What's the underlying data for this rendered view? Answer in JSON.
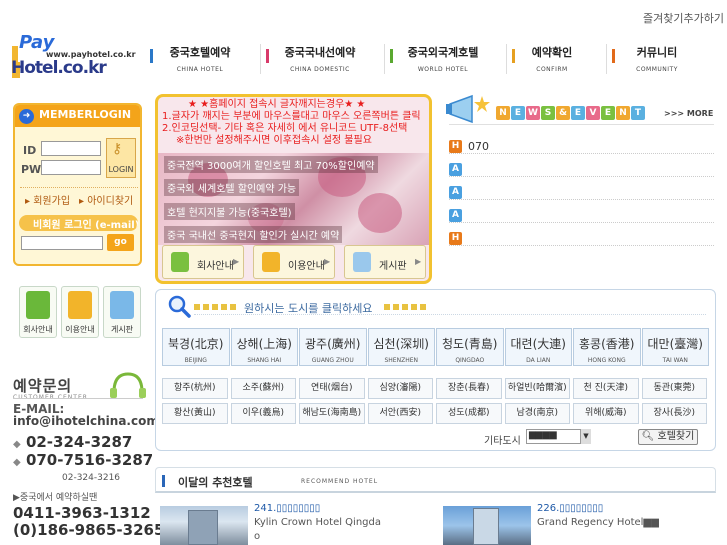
{
  "top_link": "즐겨찾기추가하기",
  "logo": {
    "line1": "Pay",
    "line2": "Hotel.co.kr",
    "url": "www.payhotel.co.kr"
  },
  "nav": [
    {
      "ko": "중국호텔예약",
      "en": "CHINA HOTEL",
      "color": "#2a78c8"
    },
    {
      "ko": "중국국내선예약",
      "en": "CHINA DOMESTIC",
      "color": "#d83a6a"
    },
    {
      "ko": "중국외국계호텔",
      "en": "WORLD HOTEL",
      "color": "#5aa830"
    },
    {
      "ko": "예약확인",
      "en": "CONFIRM",
      "color": "#e6a020"
    },
    {
      "ko": "커뮤니티",
      "en": "COMMUNITY",
      "color": "#e26a1a"
    }
  ],
  "login": {
    "title": "MEMBERLOGIN",
    "id_label": "ID",
    "pw_label": "PW",
    "login_btn": "LOGIN",
    "join": "회원가입",
    "find_id": "아이디찾기",
    "guest_label": "비회원 로그인 (e-mail)",
    "go_btn": "go"
  },
  "icon_buttons": [
    {
      "label": "회사안내",
      "color": "#6ab83a"
    },
    {
      "label": "이용안내",
      "color": "#f2b42a"
    },
    {
      "label": "게시판",
      "color": "#7ab8e8"
    }
  ],
  "contact": {
    "title": "예약문의",
    "subtitle": "CUSTOMER CENTER",
    "email_label": "E-MAIL:",
    "email": "info@ihotelchina.com",
    "phone1": "02-324-3287",
    "phone2": "070-7516-3287",
    "fax": "02-324-3216",
    "china_label": "▶중국에서 예약하실땐",
    "china_phone1": "0411-3963-1312",
    "china_phone2": "(0)186-9865-3265"
  },
  "hero": {
    "notice": [
      "★ ★홈페이지 접속시 글자깨지는경우★ ★",
      "1.글자가 깨지는 부분에 마우스를대고 마우스 오른쪽버튼 클릭",
      "2.인코딩선택- 기타 혹은 자세히 에서 유니코드 UTF-8선택",
      "※한번만 설정해주시면 이후접속시 설정 불필요"
    ],
    "promo": [
      "중국전역 3000여개 할인호텔 최고 70%할인예약",
      "중국외 세계호텔 할인예약 가능",
      "호텔 현지지불 가능(중국호텔)",
      "중국 국내선 중국현지 할인가 실시간 예약"
    ],
    "buttons": [
      "회사안내",
      "이용안내",
      "게시판"
    ]
  },
  "news": {
    "tiles": [
      "N",
      "E",
      "W",
      "S",
      "&",
      "E",
      "V",
      "E",
      "N",
      "T"
    ],
    "more": ">>> MORE",
    "items": [
      {
        "tag": "H",
        "text": "070",
        "tag_color": "#e87a1a"
      },
      {
        "tag": "A",
        "text": "",
        "tag_color": "#4aa0e0"
      },
      {
        "tag": "A",
        "text": "",
        "tag_color": "#4aa0e0"
      },
      {
        "tag": "A",
        "text": "",
        "tag_color": "#4aa0e0"
      },
      {
        "tag": "H",
        "text": "",
        "tag_color": "#e87a1a"
      }
    ]
  },
  "city": {
    "prompt": "원하시는 도시를 클릭하세요",
    "major": [
      {
        "ko": "북경(北京)",
        "en": "BEIJING"
      },
      {
        "ko": "상해(上海)",
        "en": "SHANG HAI"
      },
      {
        "ko": "광주(廣州)",
        "en": "GUANG ZHOU"
      },
      {
        "ko": "심천(深圳)",
        "en": "SHENZHEN"
      },
      {
        "ko": "청도(青島)",
        "en": "QINGDAO"
      },
      {
        "ko": "대련(大連)",
        "en": "DA LIAN"
      },
      {
        "ko": "홍콩(香港)",
        "en": "HONG KONG"
      },
      {
        "ko": "대만(臺灣)",
        "en": "TAI WAN"
      }
    ],
    "row1": [
      "항주(杭州)",
      "소주(蘇州)",
      "연태(烟台)",
      "심양(瀋陽)",
      "장춘(長春)",
      "하얼빈(哈爾濱)",
      "천 진(天津)",
      "동관(東莞)"
    ],
    "row2": [
      "황산(黃山)",
      "이우(義烏)",
      "해남도(海南島)",
      "서안(西安)",
      "성도(成都)",
      "남경(南京)",
      "위해(威海)",
      "장사(長沙)"
    ],
    "other_label": "기타도시",
    "other_value": "▆▆▆▆",
    "find_btn": "호텔찾기"
  },
  "recommend": {
    "title": "이달의 추천호텔",
    "en": "RECOMMEND HOTEL",
    "hotels": [
      {
        "name": "241.▯▯▯▯▯▯▯▯",
        "en": "Kylin Crown Hotel Qingda",
        "extra": "o"
      },
      {
        "name": "226.▯▯▯▯▯▯▯▯",
        "en": "Grand Regency Hotel▆▆",
        "extra": ""
      }
    ]
  }
}
